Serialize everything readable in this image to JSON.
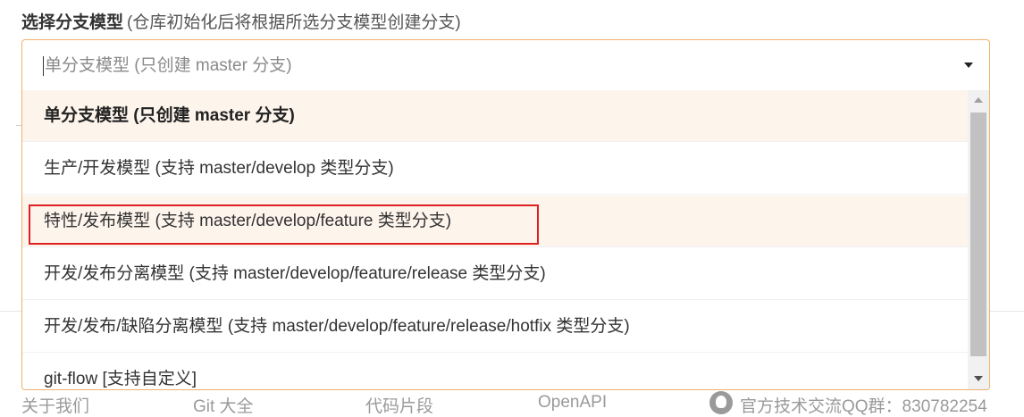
{
  "field": {
    "label": "选择分支模型",
    "hint": "(仓库初始化后将根据所选分支模型创建分支)"
  },
  "select": {
    "value": "单分支模型 (只创建 master 分支)",
    "arrow_icon": "triangle-down-icon"
  },
  "dropdown": {
    "options": [
      {
        "label": "单分支模型 (只创建 master 分支)",
        "state": "selected"
      },
      {
        "label": "生产/开发模型 (支持 master/develop 类型分支)",
        "state": "normal"
      },
      {
        "label": "特性/发布模型 (支持 master/develop/feature 类型分支)",
        "state": "hover"
      },
      {
        "label": "开发/发布分离模型 (支持 master/develop/feature/release 类型分支)",
        "state": "normal"
      },
      {
        "label": "开发/发布/缺陷分离模型 (支持 master/develop/feature/release/hotfix 类型分支)",
        "state": "normal"
      },
      {
        "label": "git-flow [支持自定义]",
        "state": "normal"
      }
    ]
  },
  "footer": {
    "about": "关于我们",
    "git_guide": "Git 大全",
    "snippets": "代码片段",
    "openapi": "OpenAPI",
    "qq_group": "官方技术交流QQ群：830782254"
  },
  "colors": {
    "focus_border": "#f0b16a",
    "option_highlight_bg": "#fdf4ec",
    "annotation_red": "#e02020"
  }
}
